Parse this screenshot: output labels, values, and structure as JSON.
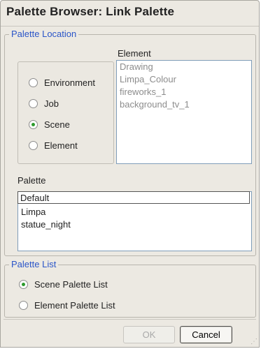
{
  "window": {
    "title": "Palette Browser:  Link Palette"
  },
  "palette_location": {
    "legend": "Palette Location",
    "element_header": "Element",
    "radios": [
      {
        "label": "Environment",
        "checked": false
      },
      {
        "label": "Job",
        "checked": false
      },
      {
        "label": "Scene",
        "checked": true
      },
      {
        "label": "Element",
        "checked": false
      }
    ],
    "elements": [
      "Drawing",
      "Limpa_Colour",
      "fireworks_1",
      "background_tv_1"
    ]
  },
  "palette": {
    "label": "Palette",
    "selected": "Default",
    "items": [
      "Limpa",
      "statue_night"
    ]
  },
  "palette_list": {
    "legend": "Palette List",
    "options": [
      {
        "label": "Scene Palette List",
        "checked": true
      },
      {
        "label": "Element Palette List",
        "checked": false
      }
    ]
  },
  "buttons": {
    "ok": "OK",
    "cancel": "Cancel"
  }
}
